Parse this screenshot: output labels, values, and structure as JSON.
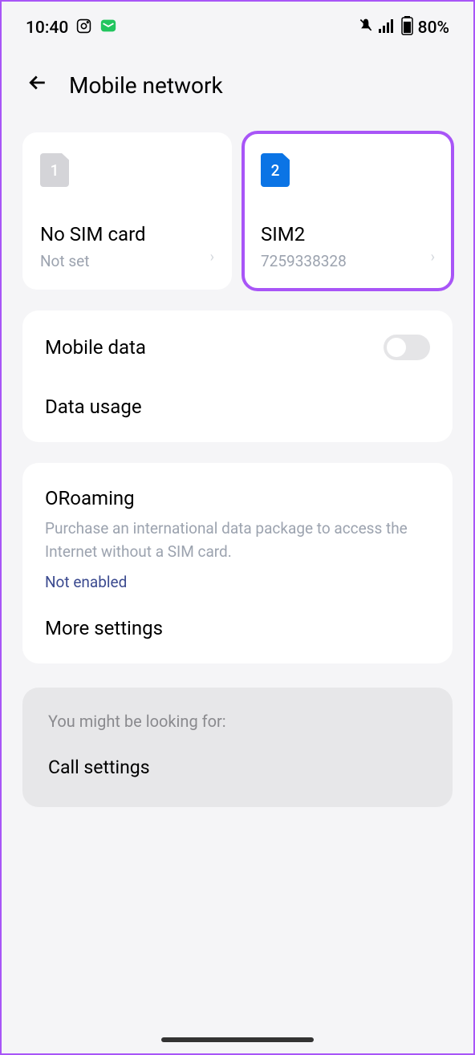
{
  "statusBar": {
    "time": "10:40",
    "battery": "80%"
  },
  "header": {
    "title": "Mobile network"
  },
  "simCards": [
    {
      "number": "1",
      "title": "No SIM card",
      "subtitle": "Not set"
    },
    {
      "number": "2",
      "title": "SIM2",
      "subtitle": "7259338328"
    }
  ],
  "dataSection": {
    "mobileData": "Mobile data",
    "dataUsage": "Data usage"
  },
  "roamingSection": {
    "title": "ORoaming",
    "description": "Purchase an international data package to access the Internet without a SIM card.",
    "status": "Not enabled",
    "moreSettings": "More settings"
  },
  "lookingFor": {
    "label": "You might be looking for:",
    "item": "Call settings"
  }
}
